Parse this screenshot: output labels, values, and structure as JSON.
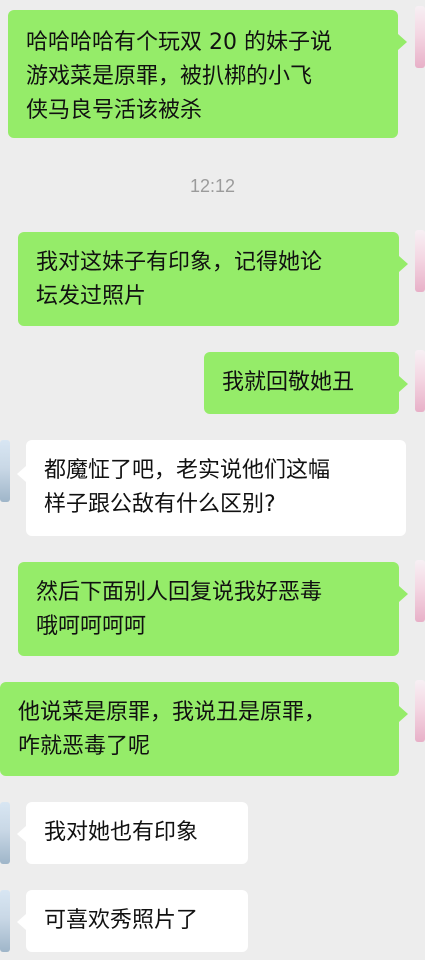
{
  "messages": [
    {
      "side": "out",
      "text": "哈哈哈哈有个玩双 20 的妹子说\n游戏菜是原罪，被扒梆的小飞\n侠马良号活该被杀"
    },
    {
      "side": "out",
      "text": "我对这妹子有印象，记得她论\n坛发过照片"
    },
    {
      "side": "out",
      "text": "我就回敬她丑"
    },
    {
      "side": "in",
      "text": "都魔怔了吧，老实说他们这幅\n样子跟公敌有什么区别?"
    },
    {
      "side": "out",
      "text": "然后下面别人回复说我好恶毒\n哦呵呵呵呵"
    },
    {
      "side": "out",
      "text": "他说菜是原罪，我说丑是原罪，\n咋就恶毒了呢"
    },
    {
      "side": "in",
      "text": "我对她也有印象"
    },
    {
      "side": "in",
      "text": "可喜欢秀照片了"
    }
  ],
  "timestamp": "12:12",
  "colors": {
    "background": "#ededed",
    "outgoing_bubble": "#95ec69",
    "incoming_bubble": "#ffffff",
    "text": "#111111",
    "timestamp": "#9b9b9b"
  }
}
